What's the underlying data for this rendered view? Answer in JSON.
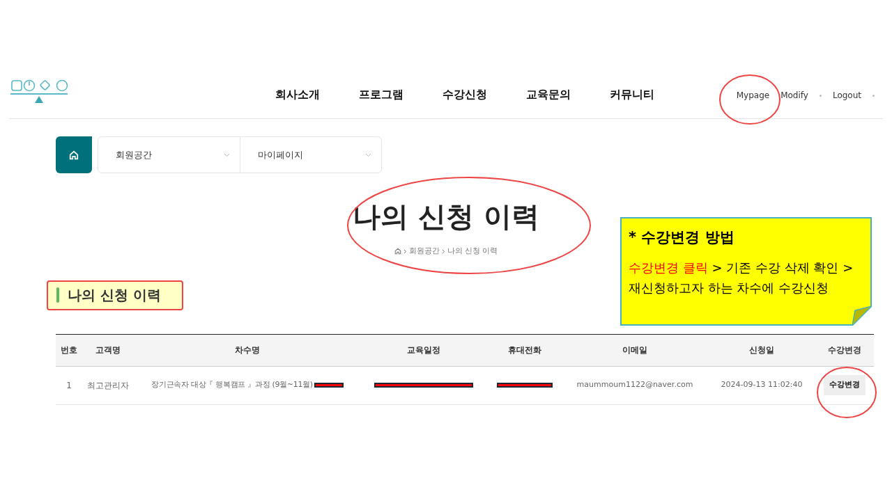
{
  "header": {
    "nav": [
      "회사소개",
      "프로그램",
      "수강신청",
      "교육문의",
      "커뮤니티"
    ],
    "user_links": [
      {
        "label": "Mypage",
        "dot": false
      },
      {
        "label": "Modify",
        "dot": true
      },
      {
        "label": "Logout",
        "dot": true
      }
    ]
  },
  "location_bar": {
    "selects": [
      "회원공간",
      "마이페이지"
    ]
  },
  "page_title": "나의 신청 이력",
  "breadcrumb": [
    "회원공간",
    "나의 신청 이력"
  ],
  "section_title": "나의 신청 이력",
  "note": {
    "title": "* 수강변경 방법",
    "segments": [
      {
        "text": "수강변경 클릭",
        "color": "#ff0000"
      },
      {
        "text": " > 기존 수강 삭제 확인 > 재신청하고자 하는 차수에 수강신청",
        "color": "#000000"
      }
    ]
  },
  "table": {
    "columns": [
      "번호",
      "고객명",
      "차수명",
      "교육일정",
      "휴대전화",
      "이메일",
      "신청일",
      "수강변경"
    ],
    "rows": [
      {
        "number": "1",
        "customer": "최고관리자",
        "course": "장기근속자 대상『 행복캠프 』과정 (9월~11월)",
        "course_redacted": true,
        "schedule_redacted": true,
        "phone_redacted": true,
        "email": "maummoum1122@naver.com",
        "applied": "2024-09-13 11:02:40",
        "action": "수강변경"
      }
    ]
  }
}
